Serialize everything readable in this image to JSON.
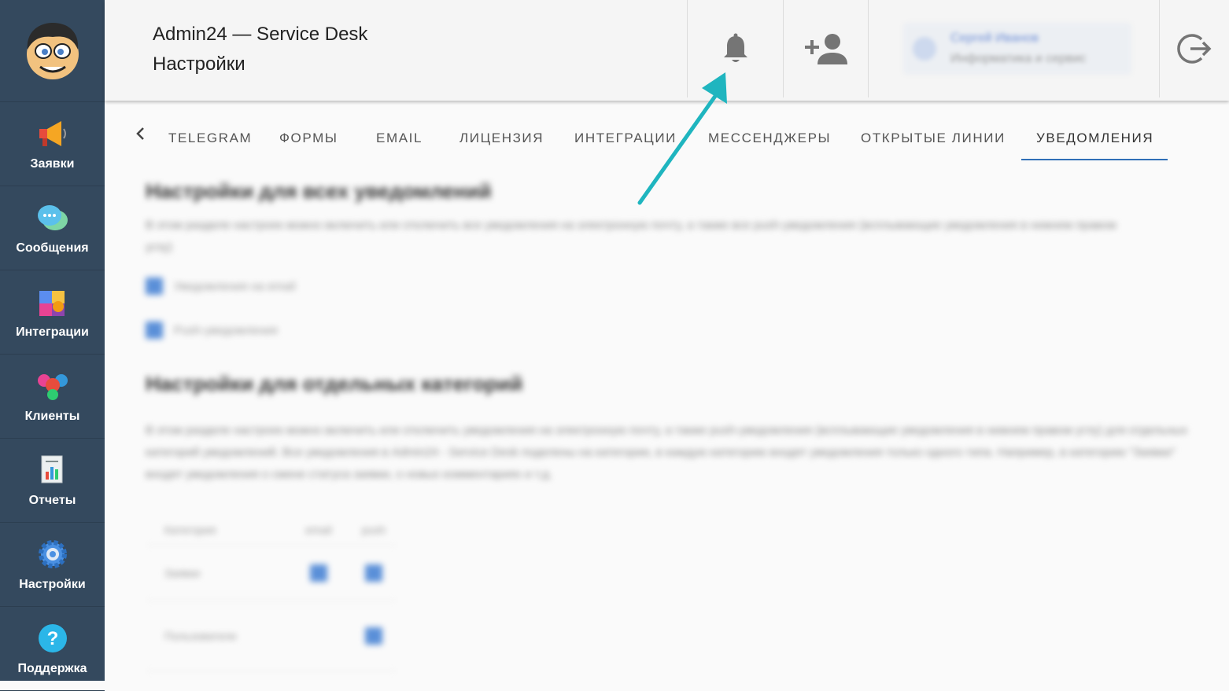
{
  "app": {
    "title": "Admin24 — Service Desk",
    "subtitle": "Настройки"
  },
  "sidebar": {
    "items": [
      {
        "label": "Заявки",
        "icon": "megaphone-icon"
      },
      {
        "label": "Сообщения",
        "icon": "chat-bubbles-icon"
      },
      {
        "label": "Интеграции",
        "icon": "puzzle-icon"
      },
      {
        "label": "Клиенты",
        "icon": "people-icon"
      },
      {
        "label": "Отчеты",
        "icon": "report-icon"
      },
      {
        "label": "Настройки",
        "icon": "gear-icon"
      },
      {
        "label": "Поддержка",
        "icon": "help-icon"
      }
    ]
  },
  "header": {
    "buttons": [
      "bell-icon",
      "add-user-icon",
      "logout-icon"
    ],
    "user": {
      "name": "Сергей Иванов",
      "role": "Информатика и сервис"
    }
  },
  "tabs": {
    "items": [
      "TELEGRAM",
      "ФОРМЫ",
      "EMAIL",
      "ЛИЦЕНЗИЯ",
      "ИНТЕГРАЦИИ",
      "МЕССЕНДЖЕРЫ",
      "ОТКРЫТЫЕ ЛИНИИ",
      "УВЕДОМЛЕНИЯ"
    ],
    "active": "УВЕДОМЛЕНИЯ"
  },
  "content": {
    "section1_title": "Настройки для всех уведомлений",
    "section1_desc": "В этом разделе настроек можно включить или отключить все уведомления на электронную почту, а также все push-уведомления (всплывающие уведомления в нижнем правом углу)",
    "check1": "Уведомления на email",
    "check2": "Push-уведомления",
    "section2_title": "Настройки для отдельных категорий",
    "section2_desc": "В этом разделе настроек можно включить или отключить уведомления на электронную почту, а также push-уведомления (всплывающие уведомления в нижнем правом углу) для отдельных категорий уведомлений. Все уведомления в Admin24 - Service Desk поделены на категории, в каждую категорию входят уведомления только одного типа. Например, в категорию \"Заявки\" входят уведомления о смене статуса заявки, о новых комментариях и т.д.",
    "table": {
      "headers": [
        "Категория",
        "email",
        "push"
      ],
      "rows": [
        {
          "name": "Заявки",
          "email": true,
          "push": true
        },
        {
          "name": "Пользователи",
          "email": false,
          "push": true
        }
      ]
    }
  },
  "colors": {
    "sidebar_bg": "#34495e",
    "accent": "#2f6fb7",
    "arrow": "#1fb5bf"
  }
}
